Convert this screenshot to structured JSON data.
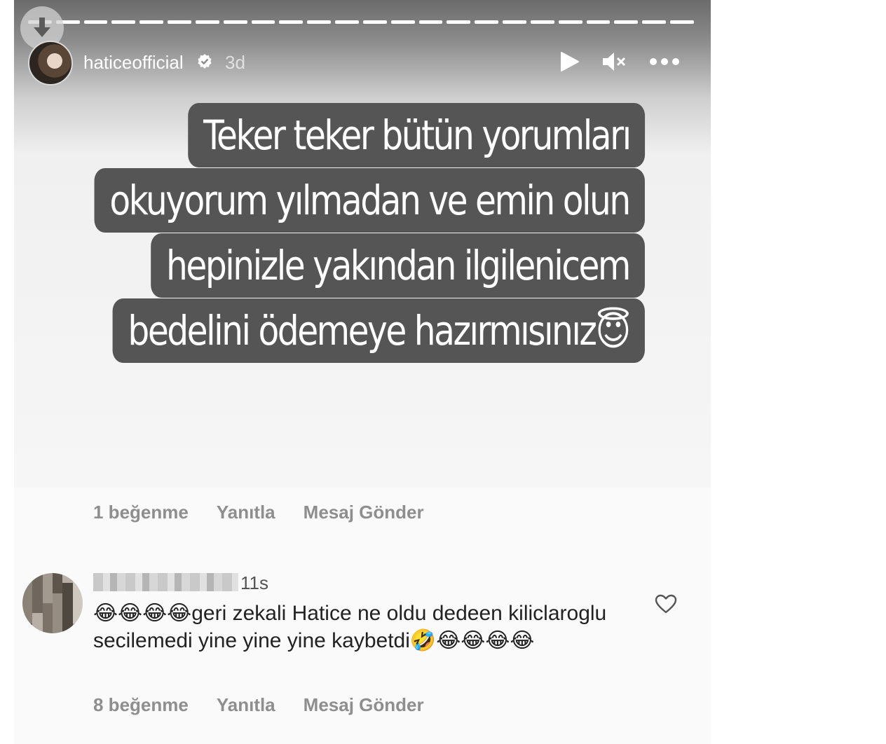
{
  "story": {
    "username": "haticeofficial",
    "time_ago": "3d",
    "progress_segments": 24,
    "caption": [
      "Teker teker bütün yorumları",
      "okuyorum yılmadan ve emin olun",
      "hepinizle yakından ilgilenicem",
      "bedelini ödemeye hazırmısınız"
    ],
    "caption_emoji": "😇"
  },
  "reply_actions": {
    "likes": "1 beğenme",
    "reply": "Yanıtla",
    "message": "Mesaj Gönder"
  },
  "comment": {
    "time_ago": "11s",
    "text": "😂😂😂😂geri zekali Hatice ne oldu dedeen kiliclaroglu secilemedi yine yine yine  kaybetdi🤣😂😂😂😂",
    "likes": "8 beğenme",
    "reply": "Yanıtla",
    "message": "Mesaj Gönder"
  },
  "icons": {
    "download": "download-arrow-icon",
    "verified": "verified-badge-icon",
    "play": "play-icon",
    "mute": "mute-icon",
    "more": "more-dots-icon",
    "like": "heart-outline-icon"
  },
  "colors": {
    "caption_bg": "#555555",
    "meta_text": "#8e8e8e"
  }
}
